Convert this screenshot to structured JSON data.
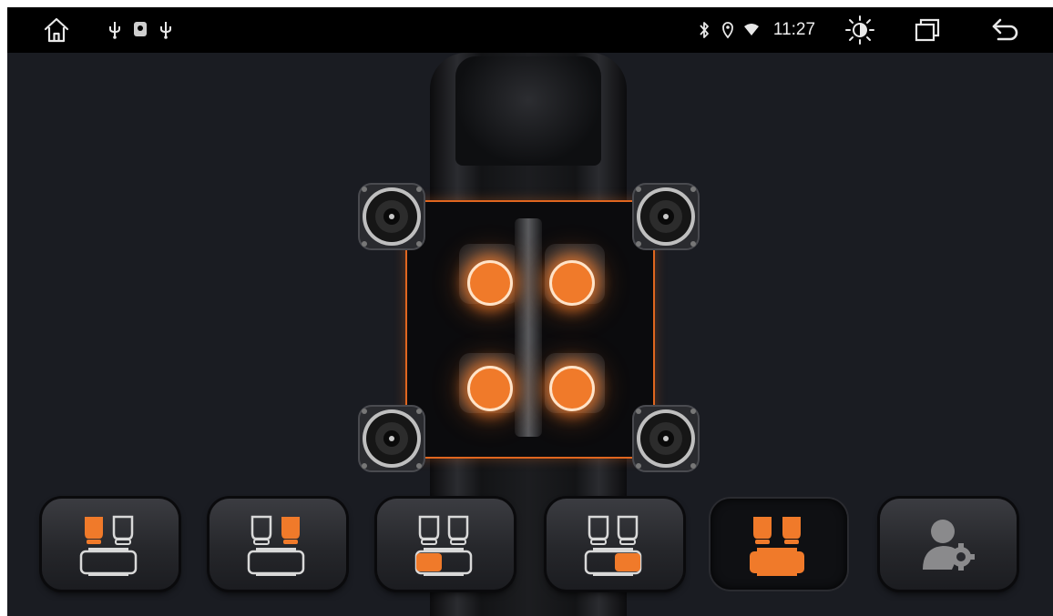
{
  "status_bar": {
    "home_icon": "home-icon",
    "notification_icons": [
      "usb-icon",
      "location-pin-icon",
      "usb-icon"
    ],
    "system_icons": [
      "bluetooth-icon",
      "location-icon",
      "wifi-icon"
    ],
    "time": "11:27",
    "brightness_icon": "brightness-icon",
    "recent_apps_icon": "recent-apps-icon",
    "back_icon": "back-icon"
  },
  "sound_field": {
    "zones": [
      "front-left",
      "front-right",
      "rear-left",
      "rear-right"
    ],
    "accent_color": "#f07a2a",
    "speakers": [
      "front-left",
      "front-right",
      "rear-left",
      "rear-right"
    ]
  },
  "seat_modes": [
    {
      "id": "driver",
      "icon": "driver-seat-icon",
      "active": false
    },
    {
      "id": "front-passenger",
      "icon": "front-passenger-seat-icon",
      "active": false
    },
    {
      "id": "rear-left",
      "icon": "rear-left-seat-icon",
      "active": false
    },
    {
      "id": "rear-right",
      "icon": "rear-right-seat-icon",
      "active": false
    },
    {
      "id": "all-seats",
      "icon": "all-seats-icon",
      "active": true
    },
    {
      "id": "custom",
      "icon": "user-settings-icon",
      "active": false
    }
  ],
  "colors": {
    "background": "#1a1c22",
    "status_bar": "#000000",
    "accent": "#f07a2a",
    "outline_icon": "#d9d9d9"
  }
}
